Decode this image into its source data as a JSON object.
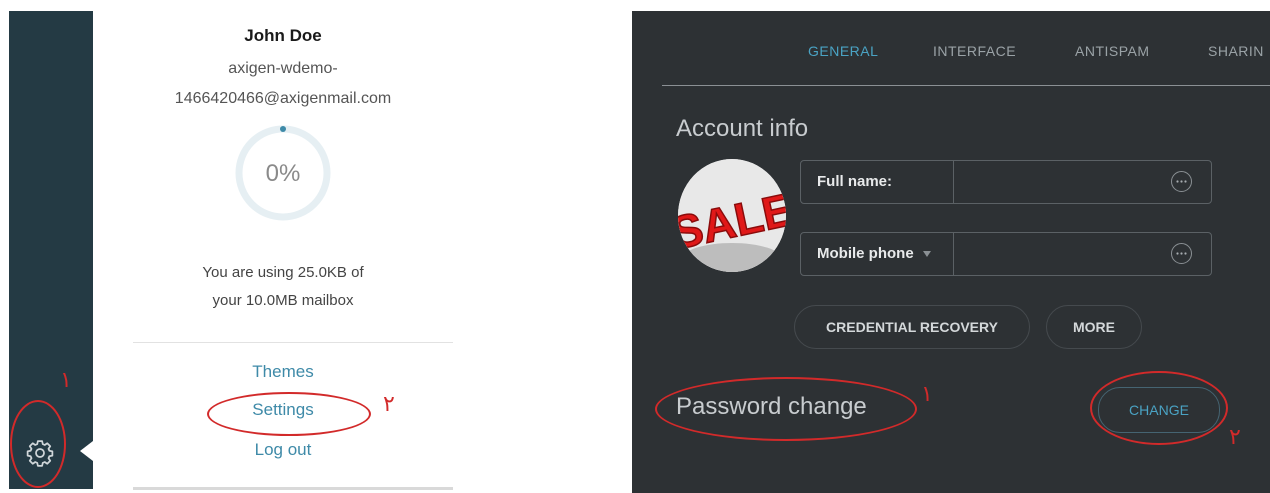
{
  "left": {
    "user_name": "John Doe",
    "email_line1": "axigen-wdemo-",
    "email_line2": "1466420466@axigenmail.com",
    "usage_percent_label": "0%",
    "usage_fraction": 0.0,
    "usage_line1": "You are using 25.0KB of",
    "usage_line2": "your 10.0MB mailbox",
    "menu": {
      "themes": "Themes",
      "settings": "Settings",
      "logout": "Log out"
    },
    "annotations": {
      "num1": "١",
      "num2": "٢"
    }
  },
  "right": {
    "tabs": [
      "GENERAL",
      "INTERFACE",
      "ANTISPAM",
      "SHARIN"
    ],
    "active_tab": "GENERAL",
    "account_info_title": "Account info",
    "avatar_text": "SALE",
    "full_name_label": "Full name:",
    "full_name_value": "",
    "mobile_phone_label": "Mobile phone",
    "mobile_phone_value": "",
    "credential_recovery_label": "CREDENTIAL RECOVERY",
    "more_label": "MORE",
    "password_change_title": "Password change",
    "change_label": "CHANGE",
    "annotations": {
      "num1": "١",
      "num2": "٢"
    }
  },
  "colors": {
    "sidebar": "#243a44",
    "accent": "#4aa3c4",
    "dark_bg": "#2d3134",
    "annotation": "#d22a2a"
  }
}
